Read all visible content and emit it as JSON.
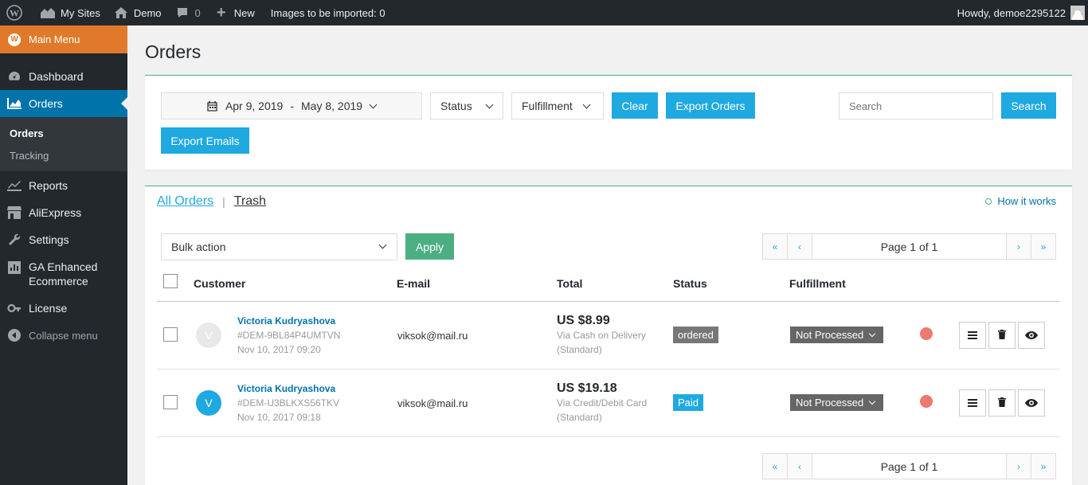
{
  "adminbar": {
    "my_sites": "My Sites",
    "site": "Demo",
    "comments_count": "0",
    "new": "New",
    "images_import": "Images to be imported: 0",
    "howdy": "Howdy, demoe2295122"
  },
  "sidebar": {
    "main_menu": "Main Menu",
    "dashboard": "Dashboard",
    "orders": "Orders",
    "sub_orders": "Orders",
    "sub_tracking": "Tracking",
    "reports": "Reports",
    "aliexpress": "AliExpress",
    "settings": "Settings",
    "ga_line1": "GA Enhanced",
    "ga_line2": "Ecommerce",
    "license": "License",
    "collapse": "Collapse menu"
  },
  "page": {
    "title": "Orders"
  },
  "filters": {
    "date_from": "Apr 9, 2019",
    "date_sep": "-",
    "date_to": "May 8, 2019",
    "status": "Status",
    "fulfillment": "Fulfillment",
    "clear": "Clear",
    "export_orders": "Export Orders",
    "export_emails": "Export Emails",
    "search_placeholder": "Search",
    "search_button": "Search"
  },
  "orders": {
    "tab_all": "All Orders",
    "tab_trash": "Trash",
    "how_it_works": "How it works",
    "bulk_action": "Bulk action",
    "apply": "Apply",
    "page_label": "Page 1 of 1",
    "columns": {
      "customer": "Customer",
      "email": "E-mail",
      "total": "Total",
      "status": "Status",
      "fulfillment": "Fulfillment"
    },
    "rows": [
      {
        "initial": "V",
        "name": "Victoria Kudryashova",
        "order_id": "#DEM-9BL84P4UMTVN",
        "date": "Nov 10, 2017 09:20",
        "email": "viksok@mail.ru",
        "total": "US $8.99",
        "payment": "Via Cash on Delivery",
        "shipping": "(Standard)",
        "status": "ordered",
        "status_color": "#777777",
        "fulfillment": "Not Processed"
      },
      {
        "initial": "V",
        "name": "Victoria Kudryashova",
        "order_id": "#DEM-U3BLKXS56TKV",
        "date": "Nov 10, 2017 09:18",
        "email": "viksok@mail.ru",
        "total": "US $19.18",
        "payment": "Via Credit/Debit Card",
        "shipping": "(Standard)",
        "status": "Paid",
        "status_color": "#1fa9e1",
        "fulfillment": "Not Processed"
      }
    ]
  },
  "colors": {
    "accent": "#1fa9e1",
    "apply": "#4cae83",
    "wp_blue": "#0073aa",
    "main_menu": "#e07a2a",
    "dot": "#ec7a6d"
  }
}
